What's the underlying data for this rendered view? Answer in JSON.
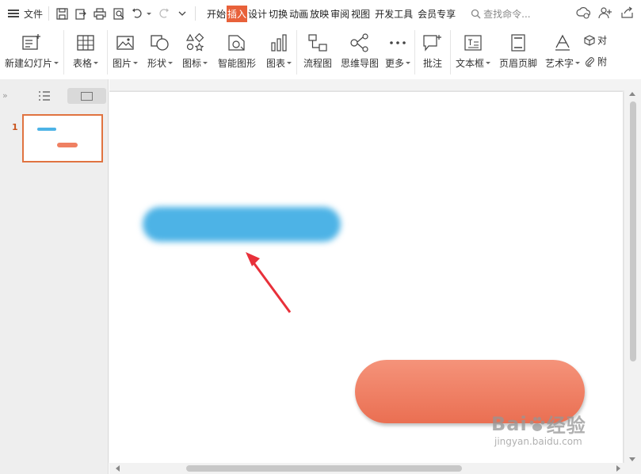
{
  "menubar": {
    "file_label": "文件",
    "tabs": [
      {
        "label": "开始",
        "active": false
      },
      {
        "label": "插入",
        "active": true
      },
      {
        "label": "设计",
        "active": false
      },
      {
        "label": "切换",
        "active": false
      },
      {
        "label": "动画",
        "active": false
      },
      {
        "label": "放映",
        "active": false
      },
      {
        "label": "审阅",
        "active": false
      },
      {
        "label": "视图",
        "active": false
      },
      {
        "label": "开发工具",
        "active": false
      },
      {
        "label": "会员专享",
        "active": false
      }
    ],
    "search_placeholder": "查找命令..."
  },
  "ribbon": {
    "new_slide": "新建幻灯片",
    "table": "表格",
    "picture": "图片",
    "shape": "形状",
    "icon": "图标",
    "smartart": "智能图形",
    "chart": "图表",
    "flowchart": "流程图",
    "mindmap": "思维导图",
    "more": "更多",
    "comment": "批注",
    "textbox": "文本框",
    "header_footer": "页眉页脚",
    "wordart": "艺术字",
    "object": "对",
    "attachment": "附"
  },
  "slides_pane": {
    "slide_number": "1"
  },
  "colors": {
    "accent": "#e8613a",
    "blue_shape": "#4db3e6",
    "orange_shape_top": "#f5937a",
    "orange_shape_bottom": "#ea6f52",
    "arrow": "#e8303a"
  },
  "watermark": {
    "brand_left": "Bai",
    "brand_right": "经验",
    "url": "jingyan.baidu.com"
  }
}
